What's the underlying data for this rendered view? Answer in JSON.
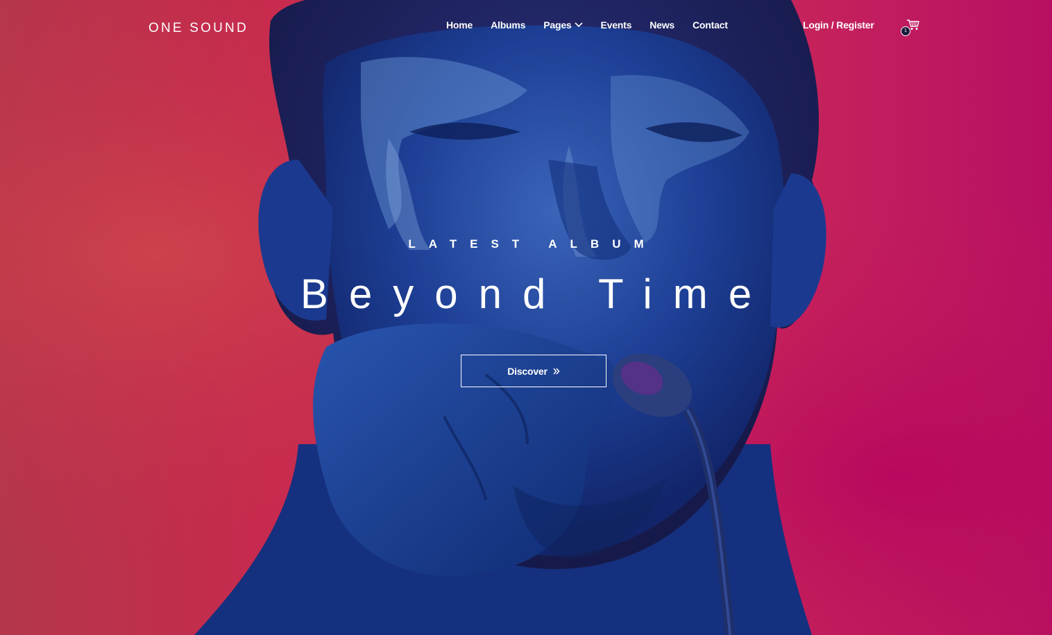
{
  "brand": {
    "name": "ONE SOUND"
  },
  "nav": {
    "items": [
      {
        "label": "Home"
      },
      {
        "label": "Albums"
      },
      {
        "label": "Pages",
        "has_dropdown": true
      },
      {
        "label": "Events"
      },
      {
        "label": "News"
      },
      {
        "label": "Contact"
      }
    ]
  },
  "account": {
    "login_label": "Login / Register"
  },
  "cart": {
    "count": "1",
    "icon": "shopping-cart-icon"
  },
  "hero": {
    "subtitle": "LATEST ALBUM",
    "title": "Beyond Time",
    "cta_label": "Discover",
    "cta_icon": "double-chevron-right-icon",
    "background": {
      "description_icon": "singer-with-microphone-image",
      "colors": {
        "left": "#c03747",
        "right": "#b80f63",
        "figure": "#1a3f8f"
      }
    }
  }
}
